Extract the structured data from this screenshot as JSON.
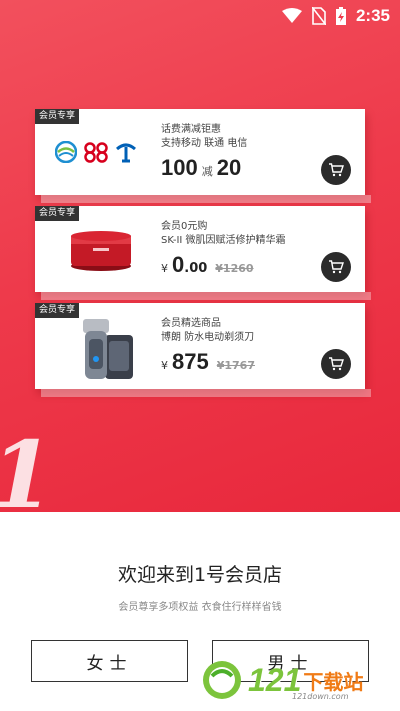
{
  "status_bar": {
    "time": "2:35"
  },
  "cards": [
    {
      "tag": "会员专享",
      "lines": [
        "话费满减钜惠",
        "支持移动 联通 电信"
      ],
      "price_main": "100",
      "price_mid": "减",
      "price_second": "20"
    },
    {
      "tag": "会员专享",
      "lines": [
        "会员0元购",
        "SK-II 微肌因赋活修护精华霜"
      ],
      "yen": "¥",
      "price_main": "0",
      "price_decimal": ".00",
      "price_orig": "¥1260"
    },
    {
      "tag": "会员专享",
      "lines": [
        "会员精选商品",
        "博朗 防水电动剃须刀"
      ],
      "yen": "¥",
      "price_main": "875",
      "price_orig": "¥1767"
    }
  ],
  "welcome": {
    "title": "欢迎来到1号会员店",
    "subtitle": "会员尊享多项权益 衣食住行样样省钱"
  },
  "buttons": {
    "female": "女士",
    "male": "男士"
  },
  "watermark": {
    "text": "121",
    "cn": "下载站",
    "url": "121down.com"
  },
  "colors": {
    "hero": "#ee3a4b",
    "cart": "#2b2b2b"
  }
}
